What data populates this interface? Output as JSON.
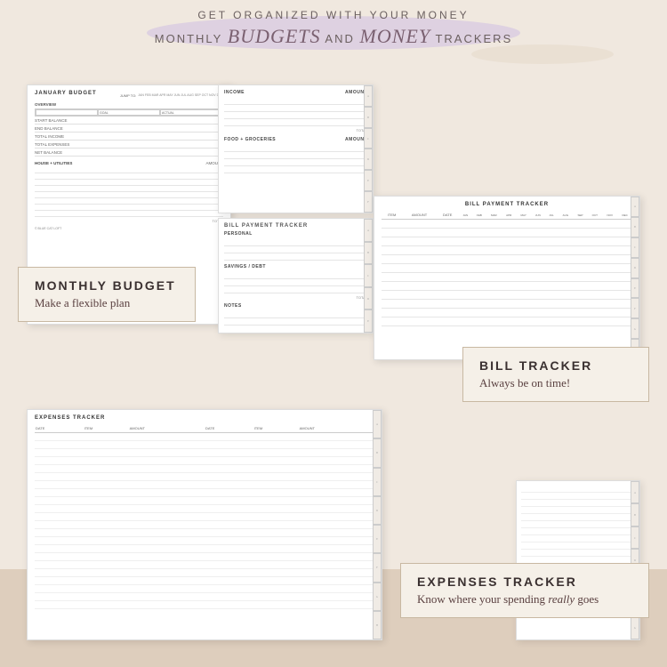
{
  "header": {
    "line1": "GET ORGANIZED WITH YOUR MONEY",
    "line2_plain": "MONTHLY",
    "line2_script1": "budgets",
    "line2_and": "AND",
    "line2_script2": "money",
    "line2_end": "TRACKERS"
  },
  "budget_card": {
    "title": "JANUARY BUDGET",
    "jump_label": "JUMP TO:",
    "months": [
      "JAN",
      "FEB",
      "MAR",
      "APR",
      "MAY",
      "JUN",
      "JUL",
      "AUG",
      "SEP",
      "OCT",
      "NOV",
      "DEC"
    ],
    "overview": "OVERVIEW",
    "goal": "GOAL",
    "actual": "ACTUAL",
    "rows": [
      "START BALANCE",
      "END BALANCE",
      "TOTAL INCOME",
      "TOTAL EXPENSES",
      "NET BALANCE"
    ],
    "house_utilities": "HOUSE + UTILITIES",
    "amount": "AMOUNT",
    "footer": "© BLUE CAT LOFT"
  },
  "income_card": {
    "title": "INCOME",
    "amount": "AMOUNT",
    "total": "TOTAL",
    "food_title": "FOOD + GROCERIES",
    "food_amount": "AMOUNT"
  },
  "personal_card": {
    "title": "PERSONAL",
    "bill_title": "BILL PAYMENT TRACKER",
    "savings_title": "SAVINGS / DEBT",
    "notes_title": "NOTES"
  },
  "bill_card": {
    "title": "BILL PAYMENT TRACKER",
    "col_item": "ITEM",
    "col_amount": "AMOUNT",
    "col_date": "DATE",
    "months": [
      "JAN",
      "FEB",
      "MAR",
      "APR",
      "MAY",
      "JUN",
      "JUL",
      "AUG",
      "SEP",
      "OCT",
      "NOV",
      "DEC"
    ]
  },
  "expenses_card": {
    "title": "EXPENSES TRACKER",
    "col_date1": "DATE",
    "col_item1": "ITEM",
    "col_amount1": "AMOUNT",
    "col_date2": "DATE",
    "col_item2": "ITEM",
    "col_amount2": "AMOUNT"
  },
  "labels": {
    "monthly_title": "MONTHLY BUDGET",
    "monthly_sub": "Make a flexible plan",
    "bill_title": "BILL TRACKER",
    "bill_sub": "Always be on time!",
    "expenses_title": "EXPENSES TRACKER",
    "expenses_sub_plain": "Know where your spending ",
    "expenses_sub_italic": "really",
    "expenses_sub_end": " goes"
  }
}
